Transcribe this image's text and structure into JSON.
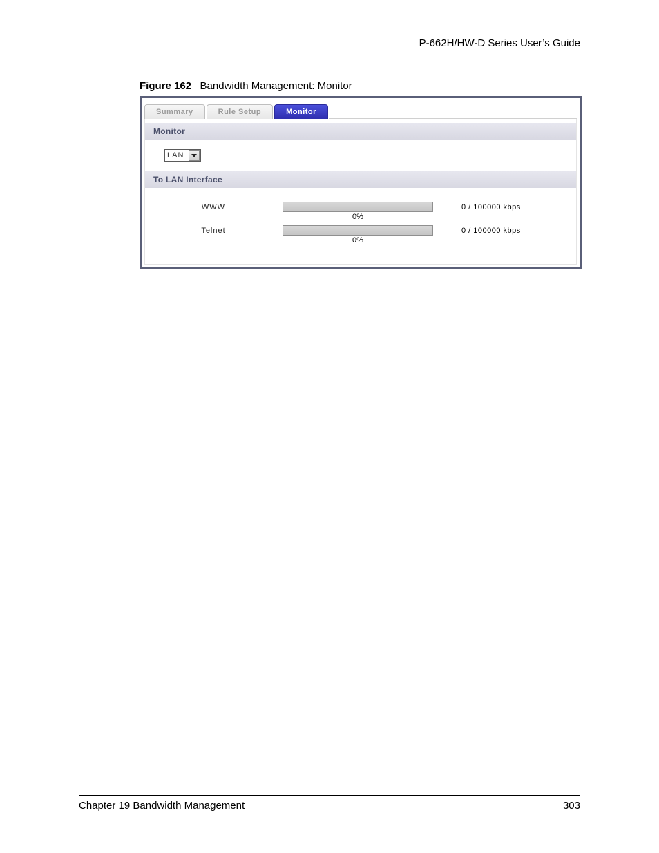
{
  "header": {
    "running_head": "P-662H/HW-D Series User’s Guide"
  },
  "figure": {
    "label": "Figure 162",
    "caption": "Bandwidth Management: Monitor"
  },
  "tabs": [
    {
      "label": "Summary",
      "active": false
    },
    {
      "label": "Rule Setup",
      "active": false
    },
    {
      "label": "Monitor",
      "active": true
    }
  ],
  "monitor": {
    "section_title": "Monitor",
    "interface_selected": "LAN",
    "interface_section_title": "To LAN Interface",
    "rows": [
      {
        "service": "WWW",
        "percent": "0%",
        "rate": "0 / 100000 kbps"
      },
      {
        "service": "Telnet",
        "percent": "0%",
        "rate": "0 / 100000 kbps"
      }
    ]
  },
  "footer": {
    "chapter": "Chapter 19 Bandwidth Management",
    "page": "303"
  }
}
